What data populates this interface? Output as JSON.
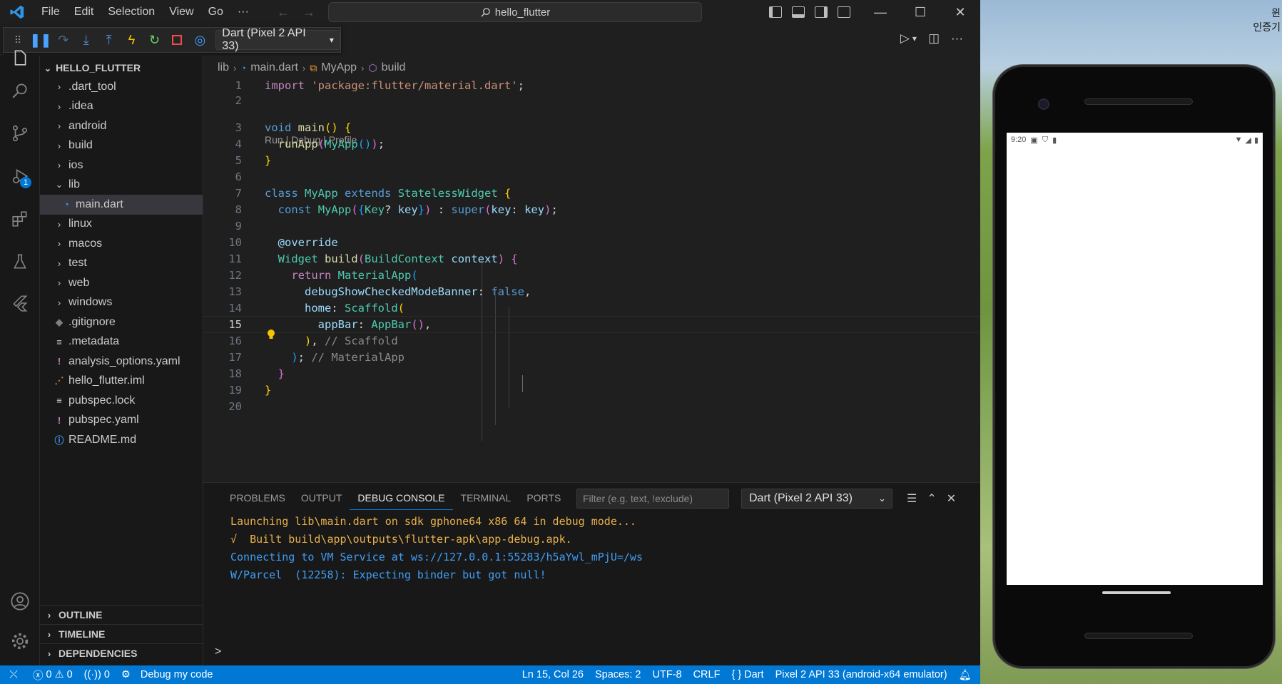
{
  "titlebar": {
    "menu": [
      "File",
      "Edit",
      "Selection",
      "View",
      "Go",
      "···"
    ],
    "search_text": "hello_flutter",
    "controls": [
      "—",
      "☐",
      "✕"
    ]
  },
  "debug_toolbar": {
    "target": "Dart (Pixel 2 API 33)"
  },
  "activitybar": {
    "run_badge": "1"
  },
  "explorer": {
    "title": "HELLO_FLUTTER",
    "items": [
      {
        "label": ".dart_tool",
        "kind": "folder"
      },
      {
        "label": ".idea",
        "kind": "folder"
      },
      {
        "label": "android",
        "kind": "folder"
      },
      {
        "label": "build",
        "kind": "folder"
      },
      {
        "label": "ios",
        "kind": "folder"
      },
      {
        "label": "lib",
        "kind": "folder-open"
      },
      {
        "label": "main.dart",
        "kind": "dart"
      },
      {
        "label": "linux",
        "kind": "folder"
      },
      {
        "label": "macos",
        "kind": "folder"
      },
      {
        "label": "test",
        "kind": "folder"
      },
      {
        "label": "web",
        "kind": "folder"
      },
      {
        "label": "windows",
        "kind": "folder"
      },
      {
        "label": ".gitignore",
        "kind": "git"
      },
      {
        "label": ".metadata",
        "kind": "lines"
      },
      {
        "label": "analysis_options.yaml",
        "kind": "yaml"
      },
      {
        "label": "hello_flutter.iml",
        "kind": "rss"
      },
      {
        "label": "pubspec.lock",
        "kind": "lines"
      },
      {
        "label": "pubspec.yaml",
        "kind": "yaml"
      },
      {
        "label": "README.md",
        "kind": "info"
      }
    ],
    "panels": [
      "OUTLINE",
      "TIMELINE",
      "DEPENDENCIES"
    ]
  },
  "breadcrumb": [
    "lib",
    "main.dart",
    "MyApp",
    "build"
  ],
  "codelens": "Run | Debug | Profile",
  "line_numbers": [
    "1",
    "2",
    "3",
    "4",
    "5",
    "6",
    "7",
    "8",
    "9",
    "10",
    "11",
    "12",
    "13",
    "14",
    "15",
    "16",
    "17",
    "18",
    "19",
    "20"
  ],
  "panel": {
    "tabs": [
      "PROBLEMS",
      "OUTPUT",
      "DEBUG CONSOLE",
      "TERMINAL",
      "PORTS"
    ],
    "filter_placeholder": "Filter (e.g. text, !exclude)",
    "session": "Dart (Pixel 2 API 33)",
    "console_lines": [
      "Launching lib\\main.dart on sdk gphone64 x86 64 in debug mode...",
      "√  Built build\\app\\outputs\\flutter-apk\\app-debug.apk.",
      "Connecting to VM Service at ws://127.0.0.1:55283/h5aYwl_mPjU=/ws",
      "W/Parcel  (12258): Expecting binder but got null!"
    ],
    "prompt": ">"
  },
  "statusbar": {
    "errors": "0",
    "warnings": "0",
    "ports": "0",
    "debug_label": "Debug my code",
    "position": "Ln 15, Col 26",
    "spaces": "Spaces: 2",
    "encoding": "UTF-8",
    "eol": "CRLF",
    "language": "Dart",
    "device": "Pixel 2 API 33 (android-x64 emulator)"
  },
  "emulator": {
    "time": "9:20",
    "desktop_text_1": "윈",
    "desktop_text_2": "인증기"
  },
  "colors": {
    "accent": "#0078d4",
    "editor_bg": "#1f1f1f",
    "sidebar_bg": "#181818"
  }
}
